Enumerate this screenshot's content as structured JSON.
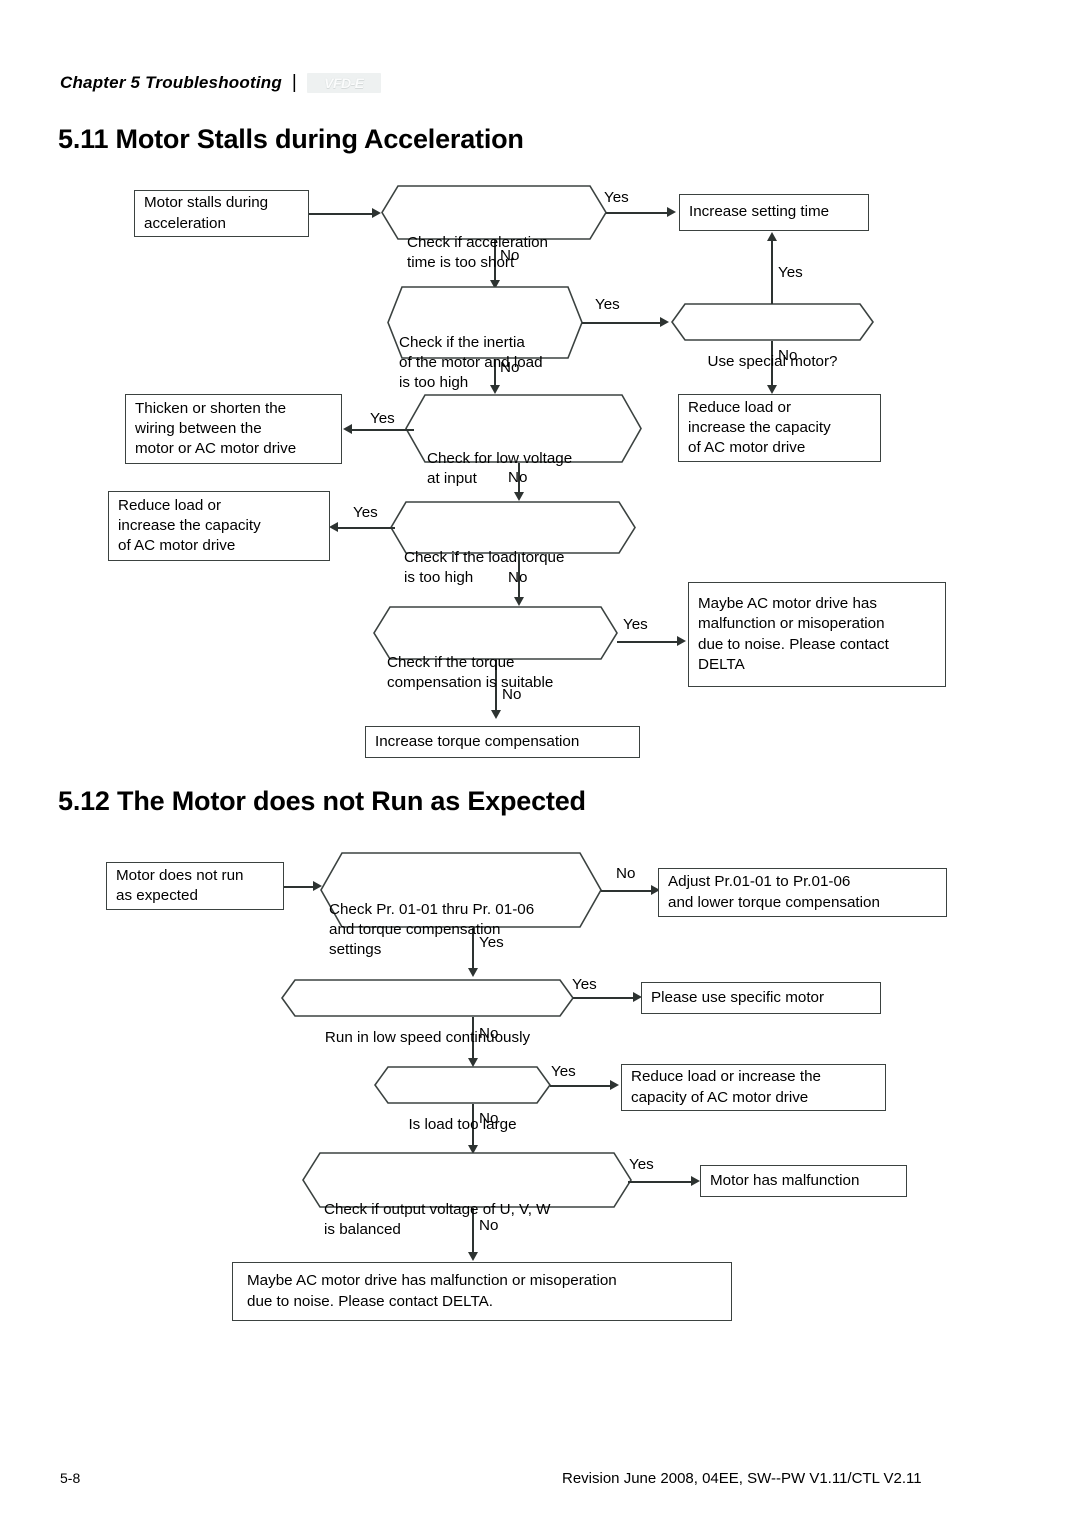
{
  "header": {
    "chapter": "Chapter 5  Troubleshooting",
    "separator": "|",
    "logo": "VFD-E"
  },
  "sections": [
    {
      "heading": "5.11 Motor Stalls during Acceleration"
    },
    {
      "heading": "5.12 The Motor does not Run as Expected"
    }
  ],
  "flowchart_1": {
    "title": "Motor Stalls during Acceleration",
    "nodes": {
      "start": "Motor stalls during\nacceleration",
      "check_accel_time": "Check if acceleration\ntime is too short",
      "increase_setting_time": "Increase setting time",
      "check_inertia": "Check if the inertia\nof the motor and load\nis too high",
      "use_special_motor": "Use special motor?",
      "reduce_load_right": "Reduce load or\nincrease the capacity\nof AC motor drive",
      "check_low_voltage": "Check for low voltage\nat input",
      "thicken_wiring": "Thicken or shorten the\nwiring between the\nmotor or AC motor drive",
      "check_load_torque": "Check if the load torque\nis too high",
      "reduce_load_left": "Reduce load or\nincrease the capacity\nof AC motor drive",
      "check_torque_comp": "Check if the torque\ncompensation is suitable",
      "maybe_malfunction": "Maybe AC motor drive has\nmalfunction or misoperation\ndue to noise. Please contact\nDELTA",
      "increase_torque_comp": "Increase torque compensation"
    },
    "edges": {
      "accel_yes": "Yes",
      "accel_no": "No",
      "inertia_yes": "Yes",
      "inertia_no": "No",
      "special_motor_yes": "Yes",
      "special_motor_no": "No",
      "voltage_yes": "Yes",
      "voltage_no": "No",
      "load_torque_yes": "Yes",
      "load_torque_no": "No",
      "torque_comp_yes": "Yes",
      "torque_comp_no": "No"
    }
  },
  "flowchart_2": {
    "title": "The Motor does not Run as Expected",
    "nodes": {
      "start": "Motor does not run\nas expected",
      "check_pr": "Check Pr. 01-01 thru Pr. 01-06\nand torque compensation\nsettings",
      "adjust_pr": "Adjust Pr.01-01 to Pr.01-06\nand lower torque compensation",
      "run_low_speed": "Run in low speed continuously",
      "use_specific_motor": "Please use specific motor",
      "is_load_too_large": "Is load too large",
      "reduce_load": "Reduce load or increase the\ncapacity of AC motor drive",
      "check_output_voltage": "Check if output voltage of U, V, W\nis balanced",
      "motor_malfunction": "Motor  has malfunction",
      "maybe_malfunction": "Maybe AC motor drive has malfunction or misoperation\ndue to noise. Please contact DELTA."
    },
    "edges": {
      "check_pr_no": "No",
      "check_pr_yes": "Yes",
      "low_speed_yes": "Yes",
      "low_speed_no": "No",
      "load_yes": "Yes",
      "load_no": "No",
      "voltage_yes": "Yes",
      "voltage_no": "No"
    }
  },
  "footer": {
    "page": "5-8",
    "revision": "Revision June 2008, 04EE, SW--PW V1.11/CTL V2.11"
  }
}
